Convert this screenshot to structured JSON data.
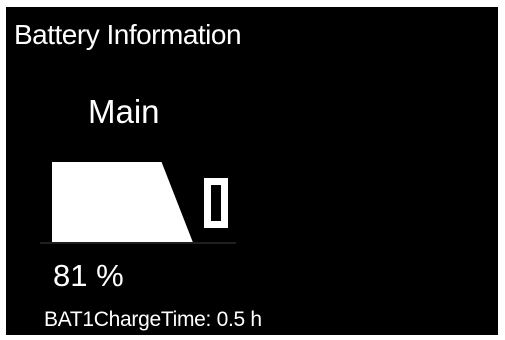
{
  "header": {
    "title": "Battery Information"
  },
  "battery": {
    "name": "Main",
    "level_percent": 81,
    "percent_text": "81 %",
    "charge_time_text": "BAT1ChargeTime: 0.5 h",
    "icon": "battery-icon"
  },
  "colors": {
    "background": "#000000",
    "foreground": "#ffffff"
  }
}
